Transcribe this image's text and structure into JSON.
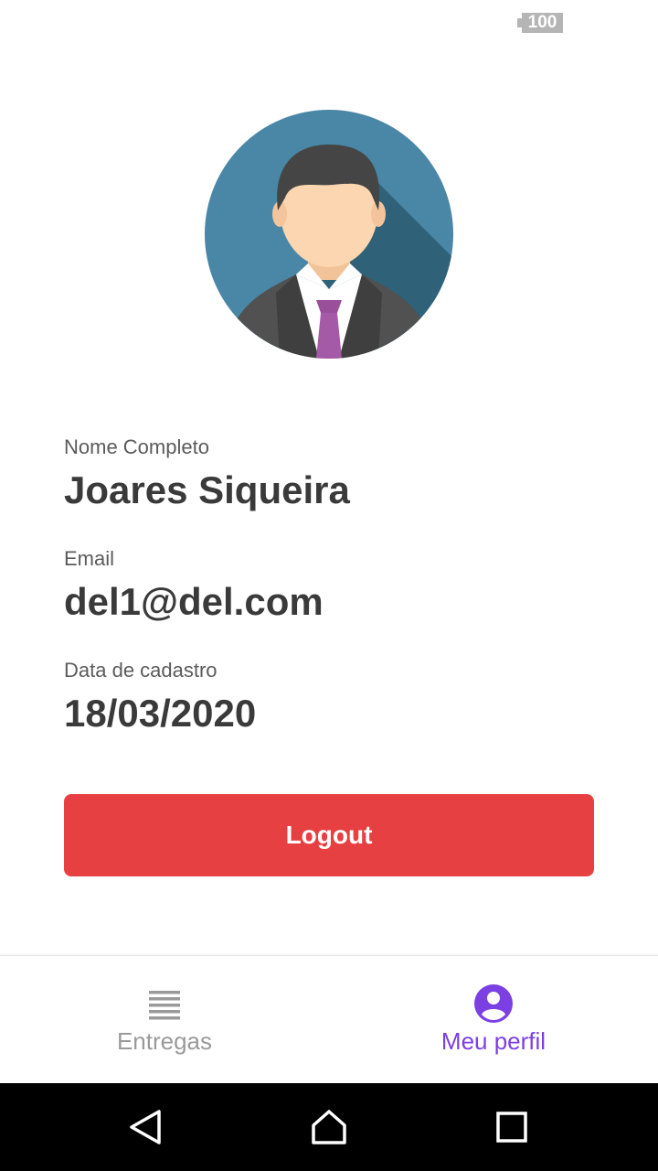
{
  "status_bar": {
    "battery_level": "100"
  },
  "profile": {
    "name_label": "Nome Completo",
    "name_value": "Joares Siqueira",
    "email_label": "Email",
    "email_value": "del1@del.com",
    "date_label": "Data de cadastro",
    "date_value": "18/03/2020"
  },
  "actions": {
    "logout_label": "Logout"
  },
  "tab_bar": {
    "tabs": [
      {
        "label": "Entregas",
        "icon": "list-icon",
        "active": false
      },
      {
        "label": "Meu perfil",
        "icon": "account-circle-icon",
        "active": true
      }
    ]
  },
  "colors": {
    "accent": "#7b3fe4",
    "danger": "#e74042",
    "text_primary": "#3a3a3a",
    "text_secondary": "#5b5b5b",
    "tab_inactive": "#9a9a9a"
  },
  "system_nav": {
    "icons": [
      "back-icon",
      "home-icon",
      "recents-icon"
    ]
  }
}
